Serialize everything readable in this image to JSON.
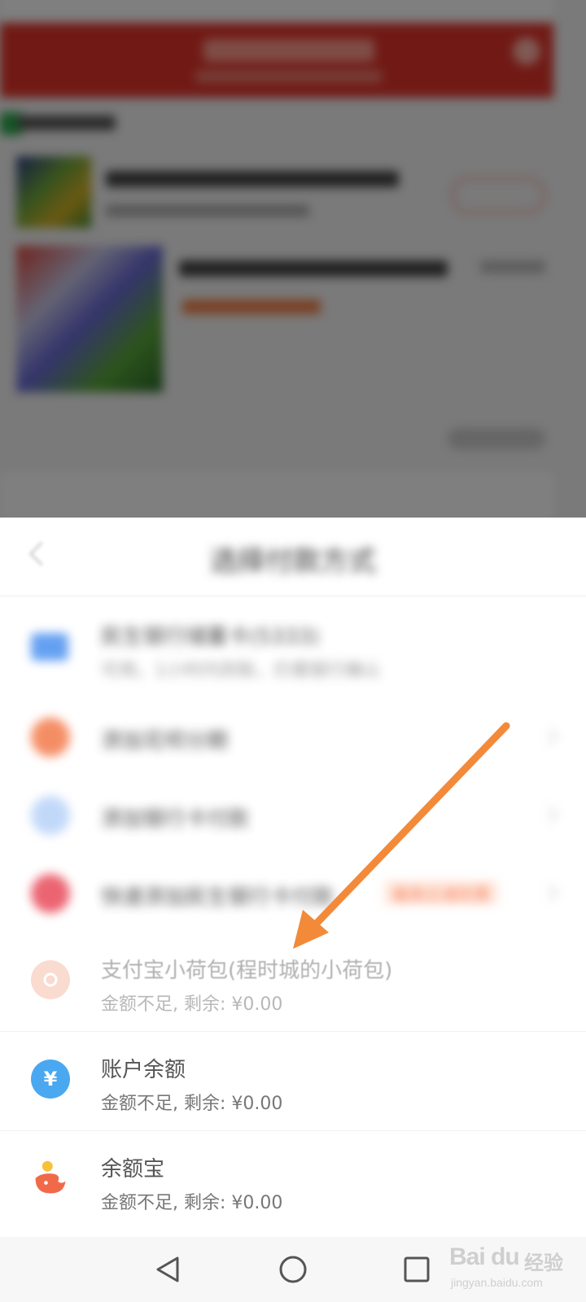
{
  "sheet": {
    "title": "选择付款方式"
  },
  "payment_methods": [
    {
      "name": "民生银行储蓄卡(5333)",
      "sub": "可用，1小时内到账，仍需银行确认",
      "icon": "bank-card-icon",
      "color": "#4a90f0"
    },
    {
      "name": "添加花呗分期",
      "sub": "",
      "icon": "huabei-icon",
      "color": "#f37a4a"
    },
    {
      "name": "添加银行卡付款",
      "sub": "",
      "icon": "add-card-icon",
      "color": "#9ec0f5"
    },
    {
      "name": "快速添加民生银行卡付款",
      "sub": "",
      "tag": "最高立减优惠",
      "icon": "red-envelope-icon",
      "color": "#e84a5a"
    },
    {
      "name": "支付宝小荷包(程时城的小荷包)",
      "sub": "金额不足, 剩余: ¥0.00",
      "icon": "small-wallet-icon",
      "color": "#f7a58a"
    },
    {
      "name": "账户余额",
      "sub": "金额不足, 剩余: ¥0.00",
      "icon": "yuan-coin-icon",
      "color": "#4aa8f0"
    },
    {
      "name": "余额宝",
      "sub": "金额不足, 剩余: ¥0.00",
      "icon": "yuebao-icon",
      "color": "#f06a4a"
    }
  ],
  "watermark": {
    "logo": "Bai du",
    "cn": "经验",
    "url": "jingyan.baidu.com"
  },
  "colors": {
    "arrow": "#f28a3a",
    "header_red": "#e2342a"
  }
}
